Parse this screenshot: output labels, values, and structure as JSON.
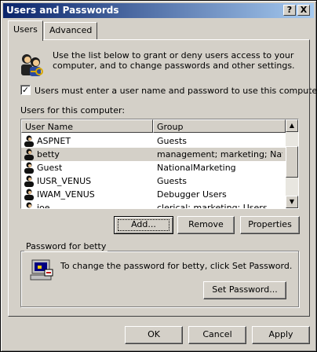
{
  "window": {
    "title": "Users and Passwords",
    "help_button": "?",
    "close_button": "X"
  },
  "tabs": [
    {
      "label": "Users",
      "active": true
    },
    {
      "label": "Advanced",
      "active": false
    }
  ],
  "intro": {
    "icon": "users-keys-icon",
    "text_line1": "Use the list below to grant or deny users access to your",
    "text_line2": "computer, and to change passwords and other settings."
  },
  "require_login": {
    "label": "Users must enter a user name and password to use this computer.",
    "checked": true,
    "mark": "✓"
  },
  "user_list": {
    "label": "Users for this computer:",
    "columns": [
      "User Name",
      "Group"
    ],
    "rows": [
      {
        "name": "ASPNET",
        "group": "Guests",
        "selected": false
      },
      {
        "name": "betty",
        "group": "management; marketing; Nati...",
        "selected": true
      },
      {
        "name": "Guest",
        "group": "NationalMarketing",
        "selected": false
      },
      {
        "name": "IUSR_VENUS",
        "group": "Guests",
        "selected": false
      },
      {
        "name": "IWAM_VENUS",
        "group": "Debugger Users",
        "selected": false
      },
      {
        "name": "joe",
        "group": "clerical; marketing; Users",
        "selected": false
      }
    ],
    "scroll_up": "▲",
    "scroll_down": "▼"
  },
  "list_buttons": {
    "add": "Add...",
    "remove": "Remove",
    "properties": "Properties"
  },
  "password_group": {
    "title": "Password for betty",
    "icon": "computer-password-icon",
    "text": "To change the password for betty, click Set Password.",
    "set_password": "Set Password..."
  },
  "dialog_buttons": {
    "ok": "OK",
    "cancel": "Cancel",
    "apply": "Apply"
  },
  "colors": {
    "titlebar_start": "#0a246a",
    "titlebar_end": "#a6caf0",
    "face": "#d4d0c8"
  }
}
